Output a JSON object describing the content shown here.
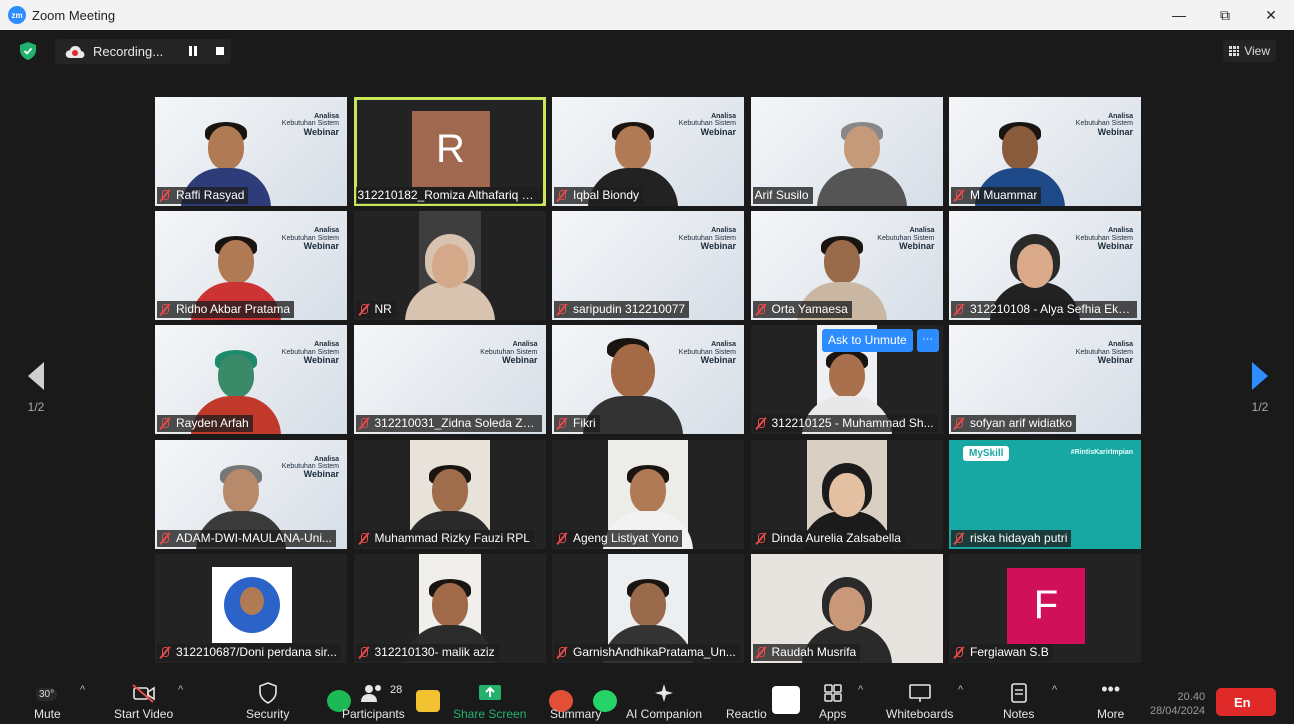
{
  "window": {
    "app_icon": "zm",
    "title": "Zoom Meeting",
    "minimize": "—",
    "maximize": "⧉",
    "close": "✕"
  },
  "topbar": {
    "recording_label": "Recording...",
    "view_label": "View"
  },
  "paging": {
    "left_label": "1/2",
    "right_label": "1/2"
  },
  "slide": {
    "line1": "Analisa",
    "line2": "Kebutuhan Sistem",
    "line3": "Webinar"
  },
  "participants": [
    {
      "name": "Raffi Rasyad",
      "muted": true
    },
    {
      "name": "312210182_Romiza Althafariq K...",
      "muted": false,
      "avatar_letter": "R",
      "avatar_color": "#a0694f"
    },
    {
      "name": "Iqbal Biondy",
      "muted": true
    },
    {
      "name": "Arif Susilo",
      "muted": false
    },
    {
      "name": "M Muammar",
      "muted": true
    },
    {
      "name": "Ridho Akbar Pratama",
      "muted": true
    },
    {
      "name": "NR",
      "muted": true
    },
    {
      "name": "saripudin 312210077",
      "muted": true
    },
    {
      "name": "Orta Yamaesa",
      "muted": true
    },
    {
      "name": "312210108 - Alya Sefhia Eka...",
      "muted": true
    },
    {
      "name": "Rayden Arfah",
      "muted": true
    },
    {
      "name": "312210031_Zidna Soleda Zu...",
      "muted": true
    },
    {
      "name": "Fikri",
      "muted": true
    },
    {
      "name": "312210125 - Muhammad Sh...",
      "muted": true
    },
    {
      "name": "sofyan arif widiatko",
      "muted": true
    },
    {
      "name": "ADAM-DWI-MAULANA-Uni...",
      "muted": true
    },
    {
      "name": "Muhammad Rizky Fauzi RPL",
      "muted": true
    },
    {
      "name": "Ageng Listiyat Yono",
      "muted": true
    },
    {
      "name": "Dinda Aurelia Zalsabella",
      "muted": true
    },
    {
      "name": "riska hidayah putri",
      "muted": true
    },
    {
      "name": "312210687/Doni perdana sir...",
      "muted": true
    },
    {
      "name": "312210130- malik aziz",
      "muted": true
    },
    {
      "name": "GarnishAndhikaPratama_Un...",
      "muted": true
    },
    {
      "name": "Raudah Musrifa",
      "muted": true
    },
    {
      "name": "Fergiawan S.B",
      "muted": true,
      "avatar_letter": "F",
      "avatar_color": "#d1105a"
    }
  ],
  "myskill": {
    "logo": "MySkill",
    "tag": "#RintisKarirImpian"
  },
  "ask_unmute": {
    "label": "Ask to Unmute",
    "more": "···"
  },
  "toolbar": {
    "temperature": "30°",
    "mute": "Mute",
    "start_video": "Start Video",
    "security": "Security",
    "participants": "Participants",
    "participants_count": "28",
    "share_screen": "Share Screen",
    "summary": "Summary",
    "ai_companion": "AI Companion",
    "reactions": "Reactio",
    "apps": "Apps",
    "whiteboards": "Whiteboards",
    "notes": "Notes",
    "more": "More",
    "clock_time": "20.40",
    "clock_date": "28/04/2024",
    "end": "En"
  },
  "colors": {
    "zoom_blue": "#2d8cff",
    "active_speaker": "#c8e85a",
    "end_red": "#e02a2a",
    "mute_red": "#e64b4b"
  }
}
